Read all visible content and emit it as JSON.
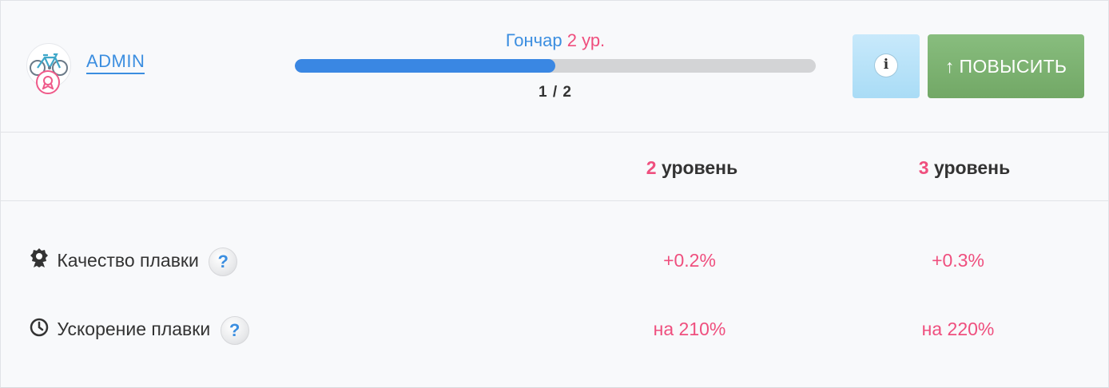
{
  "user": {
    "name": "ADMIN",
    "avatar": "bicycle-icon",
    "badge": "award-icon"
  },
  "profession": {
    "name": "Гончар",
    "level": "2 ур.",
    "progress_text": "1 / 2",
    "progress_fraction": 0.5
  },
  "buttons": {
    "info_icon": "info-icon",
    "upgrade_label": "ПОВЫСИТЬ",
    "upgrade_icon": "arrow-up-icon"
  },
  "table": {
    "columns": [
      {
        "number": "2",
        "label": "уровень"
      },
      {
        "number": "3",
        "label": "уровень"
      }
    ],
    "rows": [
      {
        "icon": "award-icon",
        "label": "Качество плавки",
        "help": "?",
        "values": [
          "+0.2%",
          "+0.3%"
        ]
      },
      {
        "icon": "clock-icon",
        "label": "Ускорение плавки",
        "help": "?",
        "values": [
          "на 210%",
          "на 220%"
        ]
      }
    ]
  },
  "colors": {
    "accent_blue": "#3b8ee0",
    "accent_pink": "#ef4f7e",
    "upgrade_green": "#7db372",
    "info_blue": "#b9e2f8"
  }
}
